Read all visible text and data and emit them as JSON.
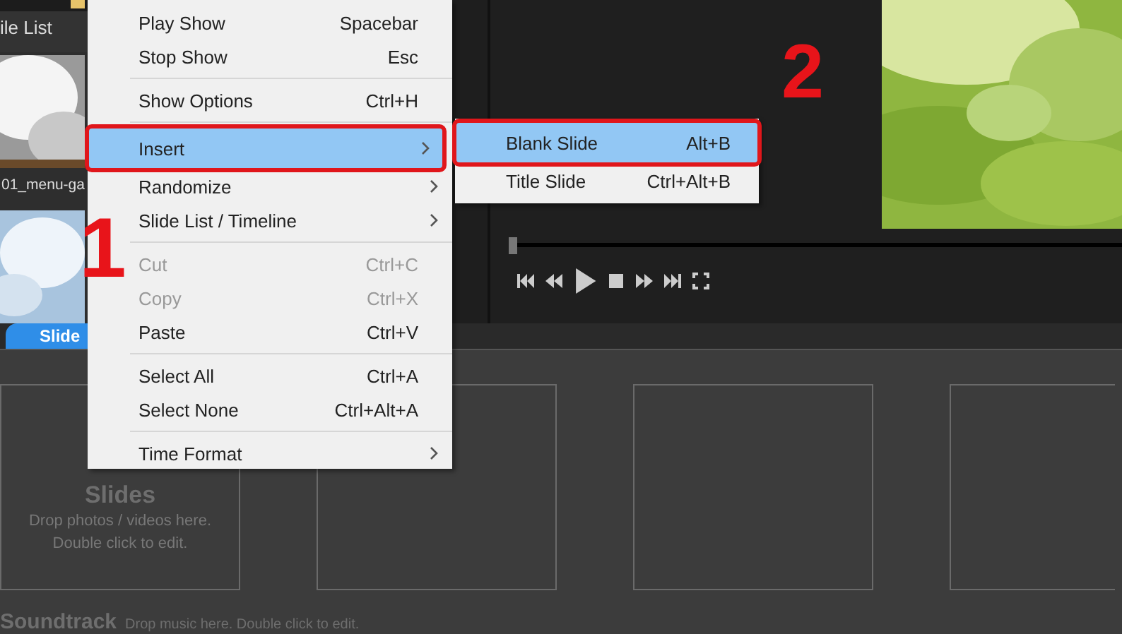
{
  "file_list": {
    "title": "ile List",
    "items": [
      {
        "label": "01_menu-ga"
      }
    ]
  },
  "context_menu": [
    {
      "kind": "item",
      "label": "Play Show",
      "shortcut": "Spacebar",
      "submenu": false,
      "disabled": false,
      "selected": false,
      "callout": false
    },
    {
      "kind": "item",
      "label": "Stop Show",
      "shortcut": "Esc",
      "submenu": false,
      "disabled": false,
      "selected": false,
      "callout": false
    },
    {
      "kind": "separator"
    },
    {
      "kind": "item",
      "label": "Show Options",
      "shortcut": "Ctrl+H",
      "submenu": false,
      "disabled": false,
      "selected": false,
      "callout": false
    },
    {
      "kind": "separator"
    },
    {
      "kind": "item",
      "label": "Insert",
      "submenu": true,
      "disabled": false,
      "selected": true,
      "callout": true
    },
    {
      "kind": "item",
      "label": "Randomize",
      "submenu": true,
      "disabled": false,
      "selected": false,
      "callout": false
    },
    {
      "kind": "item",
      "label": "Slide List / Timeline",
      "submenu": true,
      "disabled": false,
      "selected": false,
      "callout": false
    },
    {
      "kind": "separator"
    },
    {
      "kind": "item",
      "label": "Cut",
      "shortcut": "Ctrl+C",
      "submenu": false,
      "disabled": true,
      "selected": false,
      "callout": false
    },
    {
      "kind": "item",
      "label": "Copy",
      "shortcut": "Ctrl+X",
      "submenu": false,
      "disabled": true,
      "selected": false,
      "callout": false
    },
    {
      "kind": "item",
      "label": "Paste",
      "shortcut": "Ctrl+V",
      "submenu": false,
      "disabled": false,
      "selected": false,
      "callout": false
    },
    {
      "kind": "separator"
    },
    {
      "kind": "item",
      "label": "Select All",
      "shortcut": "Ctrl+A",
      "submenu": false,
      "disabled": false,
      "selected": false,
      "callout": false
    },
    {
      "kind": "item",
      "label": "Select None",
      "shortcut": "Ctrl+Alt+A",
      "submenu": false,
      "disabled": false,
      "selected": false,
      "callout": false
    },
    {
      "kind": "separator"
    },
    {
      "kind": "item",
      "label": "Time Format",
      "submenu": true,
      "disabled": false,
      "selected": false,
      "callout": false
    }
  ],
  "submenu": [
    {
      "label": "Blank Slide",
      "shortcut": "Alt+B",
      "selected": true,
      "callout": true
    },
    {
      "label": "Title Slide",
      "shortcut": "Ctrl+Alt+B",
      "selected": false,
      "callout": false
    }
  ],
  "step_numbers": [
    "1",
    "2"
  ],
  "player": {
    "level": 0.0
  },
  "tabs": [
    {
      "label": "Slide",
      "selected": true
    }
  ],
  "slides": {
    "title": "Slides",
    "hint": "Drop photos / videos here.",
    "hint2": "Double click to edit."
  },
  "soundtrack": {
    "title": "Soundtrack",
    "hint": "Drop music here.  Double click to edit."
  }
}
